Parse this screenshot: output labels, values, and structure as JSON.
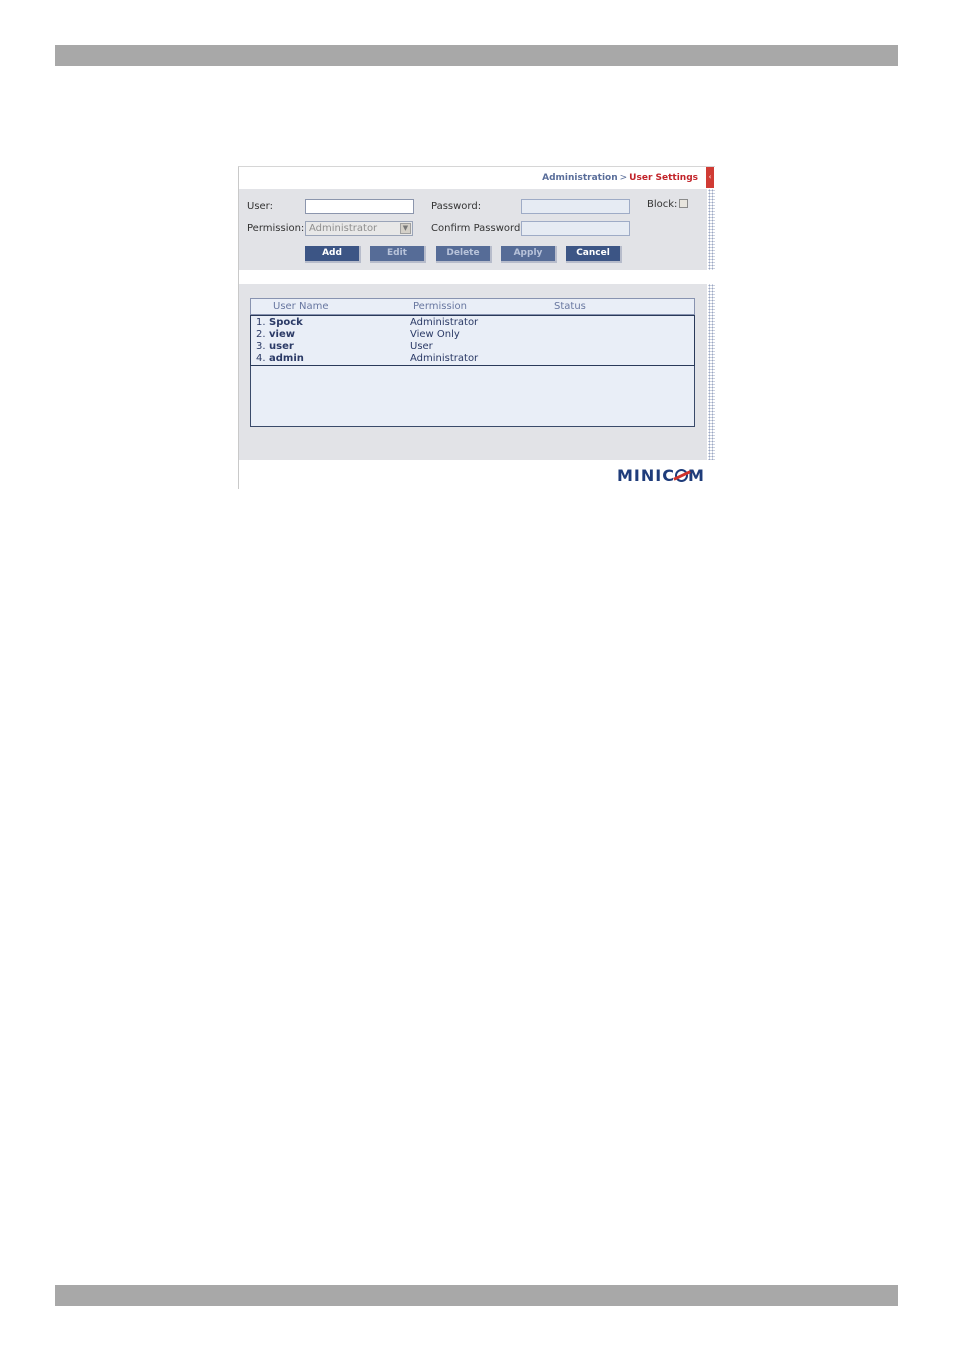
{
  "breadcrumb": {
    "parent": "Administration",
    "separator": ">",
    "current": "User Settings"
  },
  "form": {
    "user_label": "User:",
    "user_value": "",
    "password_label": "Password:",
    "password_value": "",
    "block_label": "Block:",
    "block_checked": false,
    "permission_label": "Permission:",
    "permission_value": "Administrator",
    "confirm_password_label": "Confirm Password:",
    "confirm_password_value": ""
  },
  "buttons": {
    "add": "Add",
    "edit": "Edit",
    "delete": "Delete",
    "apply": "Apply",
    "cancel": "Cancel"
  },
  "table": {
    "columns": [
      "User Name",
      "Permission",
      "Status"
    ],
    "rows": [
      {
        "num": "1.",
        "name": "Spock",
        "permission": "Administrator",
        "status": ""
      },
      {
        "num": "2.",
        "name": "view",
        "permission": "View Only",
        "status": ""
      },
      {
        "num": "3.",
        "name": "user",
        "permission": "User",
        "status": ""
      },
      {
        "num": "4.",
        "name": "admin",
        "permission": "Administrator",
        "status": ""
      }
    ]
  },
  "logo": {
    "text_before": "MINIC",
    "text_after": "M"
  },
  "colors": {
    "button": "#3c5585",
    "breadcrumb_current": "#c2242a",
    "panel": "#e2e3e7"
  }
}
